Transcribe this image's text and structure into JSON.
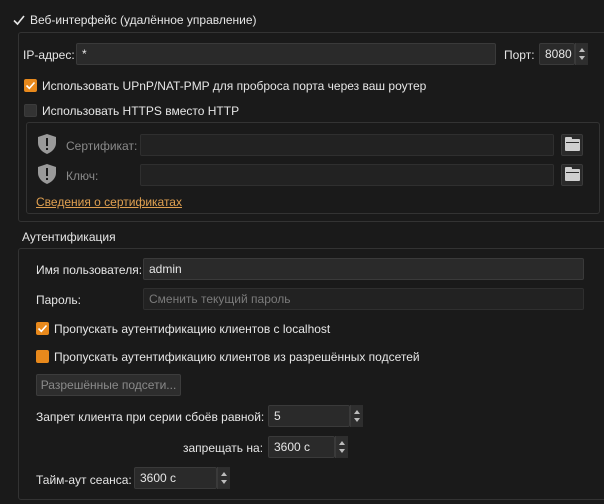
{
  "webui": {
    "title": "Веб-интерфейс (удалённое управление)",
    "enabled": true
  },
  "address": {
    "ip_label": "IP-адрес:",
    "ip_value": "*",
    "port_label": "Порт:",
    "port_value": "8080"
  },
  "upnp": {
    "label": "Использовать UPnP/NAT-PMP для проброса порта через ваш роутер",
    "checked": true
  },
  "https": {
    "label": "Использовать HTTPS вместо HTTP",
    "checked": false,
    "certificate_label": "Сертификат:",
    "certificate_value": "",
    "key_label": "Ключ:",
    "key_value": "",
    "info_link": "Сведения о сертификатах"
  },
  "auth": {
    "section_title": "Аутентификация",
    "username_label": "Имя пользователя:",
    "username_value": "admin",
    "password_label": "Пароль:",
    "password_placeholder": "Сменить текущий пароль",
    "bypass_localhost_label": "Пропускать аутентификацию клиентов с localhost",
    "bypass_localhost_checked": true,
    "bypass_subnets_label": "Пропускать аутентификацию клиентов из разрешённых подсетей",
    "bypass_subnets_state": "partial",
    "subnets_button": "Разрешённые подсети...",
    "ban_after_label": "Запрет клиента при серии сбоёв равной:",
    "ban_after_value": "5",
    "ban_for_label": "запрещать на:",
    "ban_for_value": "3600 с",
    "session_timeout_label": "Тайм-аут сеанса:",
    "session_timeout_value": "3600 с"
  },
  "colors": {
    "accent": "#e8891c",
    "link": "#e0a050",
    "background": "#1a1a1a"
  }
}
